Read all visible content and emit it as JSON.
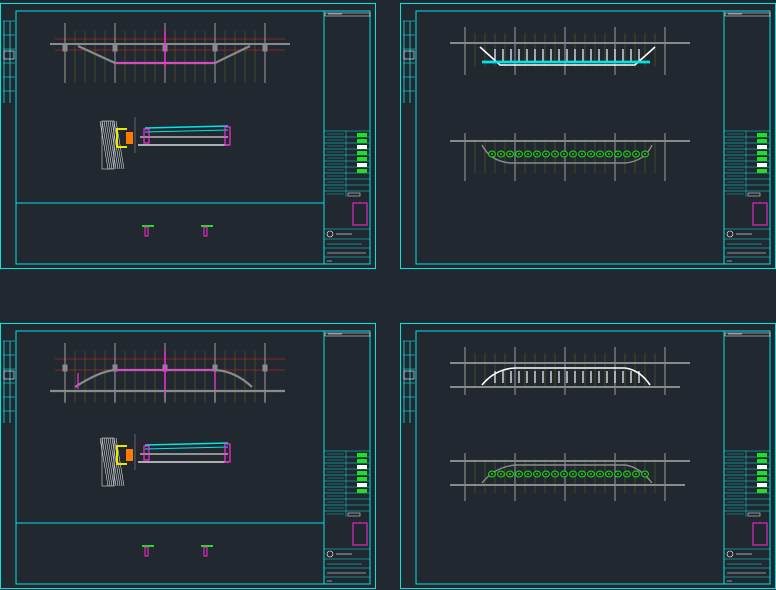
{
  "colors": {
    "background": "#212830",
    "frame": "#00e5e5",
    "magenta": "#ff2bd6",
    "green": "#22dd22",
    "yellow": "#e8e800",
    "orange": "#ff7a00",
    "red": "#e82020",
    "gray": "#8a8a8a",
    "white": "#ffffff",
    "olive": "#7a7a20"
  },
  "sheets": [
    {
      "name": "sheet-top-left",
      "kind": "section",
      "variant": "suspended"
    },
    {
      "name": "sheet-top-right",
      "kind": "plan",
      "variant": "suspended"
    },
    {
      "name": "sheet-bottom-left",
      "kind": "section",
      "variant": "arched"
    },
    {
      "name": "sheet-bottom-right",
      "kind": "plan",
      "variant": "arched"
    }
  ]
}
